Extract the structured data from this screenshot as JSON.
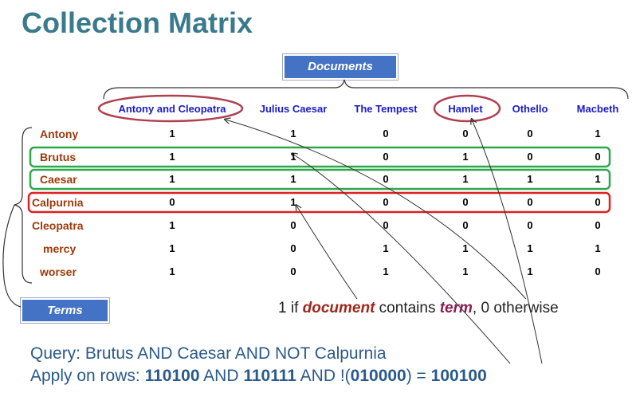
{
  "title": "Collection Matrix",
  "labels": {
    "documents": "Documents",
    "terms": "Terms"
  },
  "documents": [
    "Antony and Cleopatra",
    "Julius Caesar",
    "The Tempest",
    "Hamlet",
    "Othello",
    "Macbeth"
  ],
  "terms": [
    "Antony",
    "Brutus",
    "Caesar",
    "Calpurnia",
    "Cleopatra",
    "mercy",
    "worser"
  ],
  "matrix": [
    [
      "1",
      "1",
      "0",
      "0",
      "0",
      "1"
    ],
    [
      "1",
      "1",
      "0",
      "1",
      "0",
      "0"
    ],
    [
      "1",
      "1",
      "0",
      "1",
      "1",
      "1"
    ],
    [
      "0",
      "1",
      "0",
      "0",
      "0",
      "0"
    ],
    [
      "1",
      "0",
      "0",
      "0",
      "0",
      "0"
    ],
    [
      "1",
      "0",
      "1",
      "1",
      "1",
      "1"
    ],
    [
      "1",
      "0",
      "1",
      "1",
      "1",
      "0"
    ]
  ],
  "note": {
    "before": "1 if ",
    "document": "document",
    "middle": " contains ",
    "term": "term",
    "after": ", 0 otherwise"
  },
  "query": {
    "line1": "Query: Brutus AND Caesar AND NOT Calpurnia",
    "prefix": "Apply on rows: ",
    "v1": "110100",
    "op1": " AND ",
    "v2": "110111",
    "op2": " AND !(",
    "v3": "010000",
    "op3": ") = ",
    "result": "100100"
  },
  "colors": {
    "green": "#2ea84a",
    "red": "#e02020",
    "ellipse": "#b04050",
    "title": "#3a7a8c"
  }
}
